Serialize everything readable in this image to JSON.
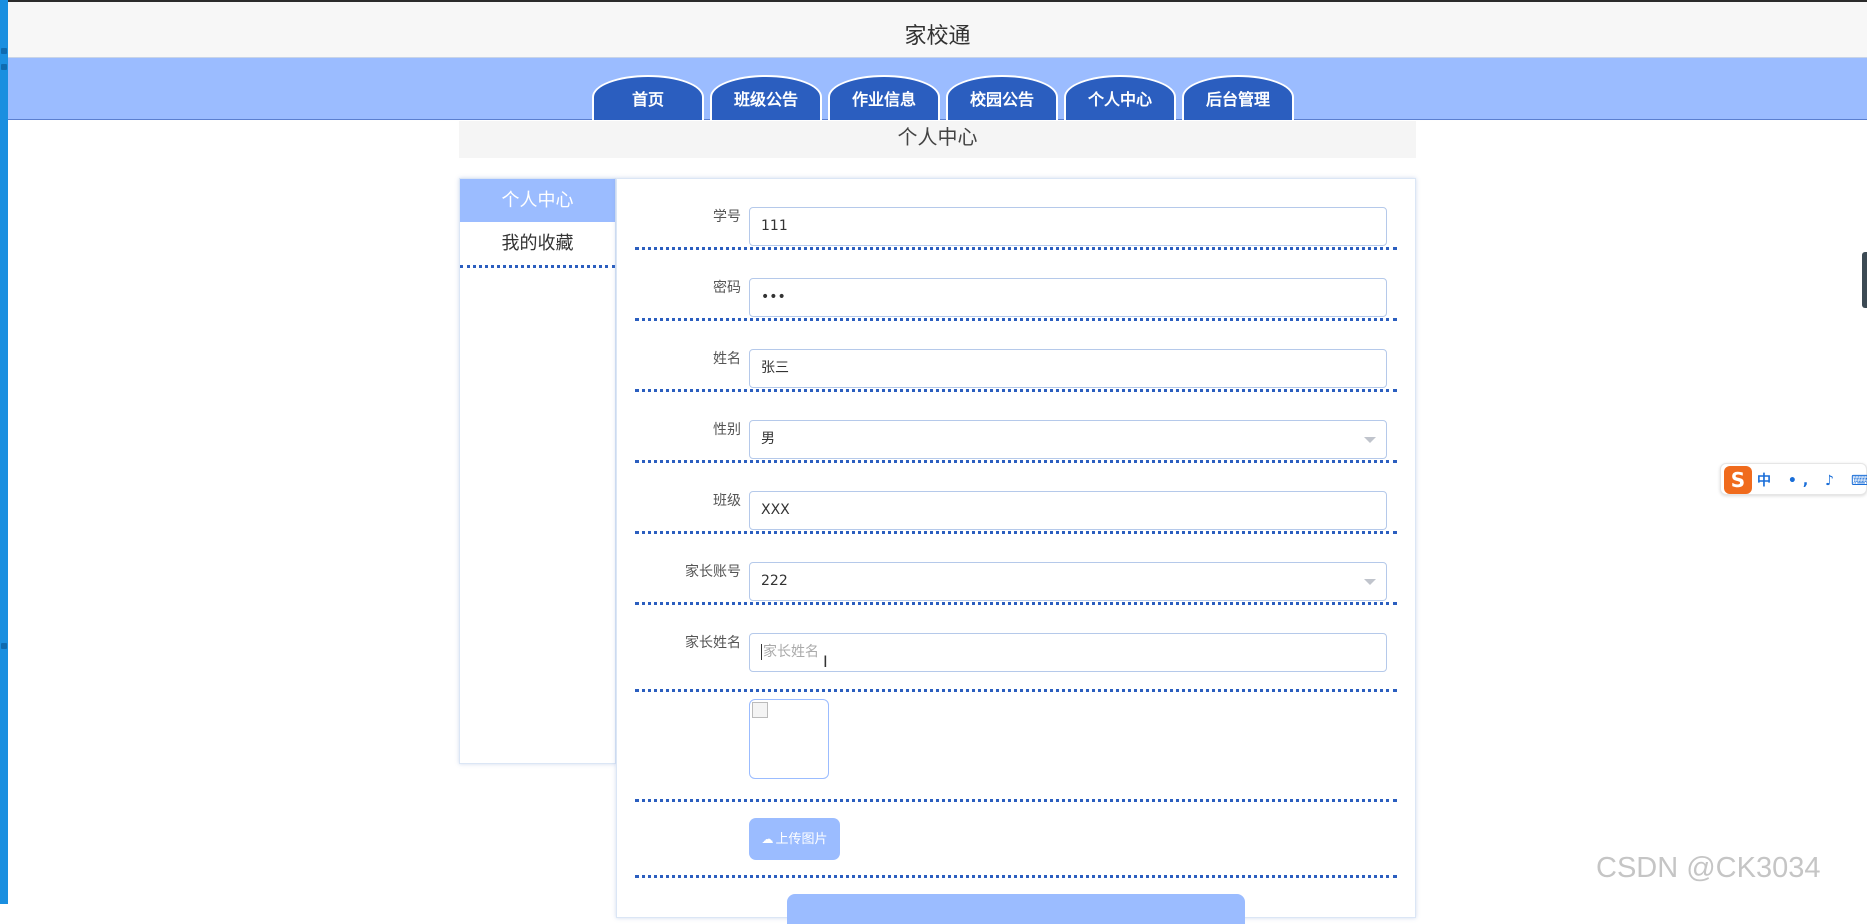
{
  "app": {
    "title": "家校通"
  },
  "nav": {
    "tabs": [
      {
        "label": "首页"
      },
      {
        "label": "班级公告"
      },
      {
        "label": "作业信息"
      },
      {
        "label": "校园公告"
      },
      {
        "label": "个人中心"
      },
      {
        "label": "后台管理"
      }
    ]
  },
  "section": {
    "title": "个人中心"
  },
  "sidebar": {
    "items": [
      {
        "label": "个人中心",
        "active": true
      },
      {
        "label": "我的收藏",
        "active": false
      }
    ]
  },
  "form": {
    "student_id": {
      "label": "学号",
      "value": "111"
    },
    "password": {
      "label": "密码",
      "value": "•••"
    },
    "name": {
      "label": "姓名",
      "value": "张三"
    },
    "gender": {
      "label": "性别",
      "value": "男"
    },
    "class": {
      "label": "班级",
      "value": "XXX"
    },
    "parent_account": {
      "label": "家长账号",
      "value": "222"
    },
    "parent_name": {
      "label": "家长姓名",
      "value": "",
      "placeholder": "家长姓名"
    },
    "upload_label": "上传图片"
  },
  "ime": {
    "logo": "S",
    "items": "中 •, ♪ ⌨ ⁘"
  },
  "colors": {
    "nav_bg": "#9bbcff",
    "tab_bg": "#2b5ebf",
    "divider": "#2b5ebf",
    "accent": "#9bbcff"
  },
  "icons": [
    "cloud-upload-icon",
    "chevron-down-icon",
    "broken-image-icon",
    "sogou-ime-icon"
  ],
  "watermark": "CSDN @CK3034"
}
